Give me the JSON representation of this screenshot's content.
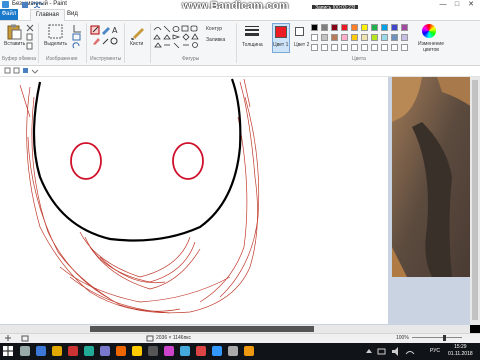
{
  "window": {
    "title": "Безымянный - Paint",
    "controls": {
      "minimize": "—",
      "maximize": "□",
      "close": "✕"
    }
  },
  "watermark": {
    "brand": "www.Bandicam.com",
    "recording": "Запись [00:03:23]"
  },
  "tabs": {
    "file": "Файл",
    "home": "Главная",
    "view": "Вид"
  },
  "ribbon": {
    "clipboard": {
      "paste": "Вставить",
      "group_label": "Буфер обмена"
    },
    "image": {
      "select": "Выделить",
      "group_label": "Изображение"
    },
    "tools": {
      "group_label": "Инструменты"
    },
    "brushes": {
      "label": "Кисти"
    },
    "shapes": {
      "outline": "Контур",
      "fill": "Заливка",
      "group_label": "Фигуры"
    },
    "size": {
      "label": "Толщина"
    },
    "color1": {
      "label": "Цвет 1",
      "color": "#ed1c24"
    },
    "color2": {
      "label": "Цвет 2",
      "color": "#ffffff"
    },
    "colors": {
      "group_label": "Цвета"
    },
    "edit_colors": {
      "label": "Изменение цветов"
    },
    "palette_row1": [
      "#000000",
      "#7f7f7f",
      "#880015",
      "#ed1c24",
      "#ff7f27",
      "#fff200",
      "#22b14c",
      "#00a2e8",
      "#3f48cc",
      "#a349a4"
    ],
    "palette_row2": [
      "#ffffff",
      "#c3c3c3",
      "#b97a57",
      "#ffaec9",
      "#ffc90e",
      "#efe4b0",
      "#b5e61d",
      "#99d9ea",
      "#7092be",
      "#c8bfe7"
    ],
    "palette_row3": [
      "#ffffff",
      "#ffffff",
      "#ffffff",
      "#ffffff",
      "#ffffff",
      "#ffffff",
      "#ffffff",
      "#ffffff",
      "#ffffff",
      "#ffffff"
    ]
  },
  "canvas": {
    "stroke_colors": {
      "outline": "#000000",
      "eyes": "#d0102a",
      "sketch": "#c0392b"
    }
  },
  "status": {
    "dimensions": "2036 × 1146пкс",
    "zoom": "100%"
  },
  "taskbar": {
    "language": "РУС",
    "time": "15:29",
    "date": "01.11.2018"
  }
}
